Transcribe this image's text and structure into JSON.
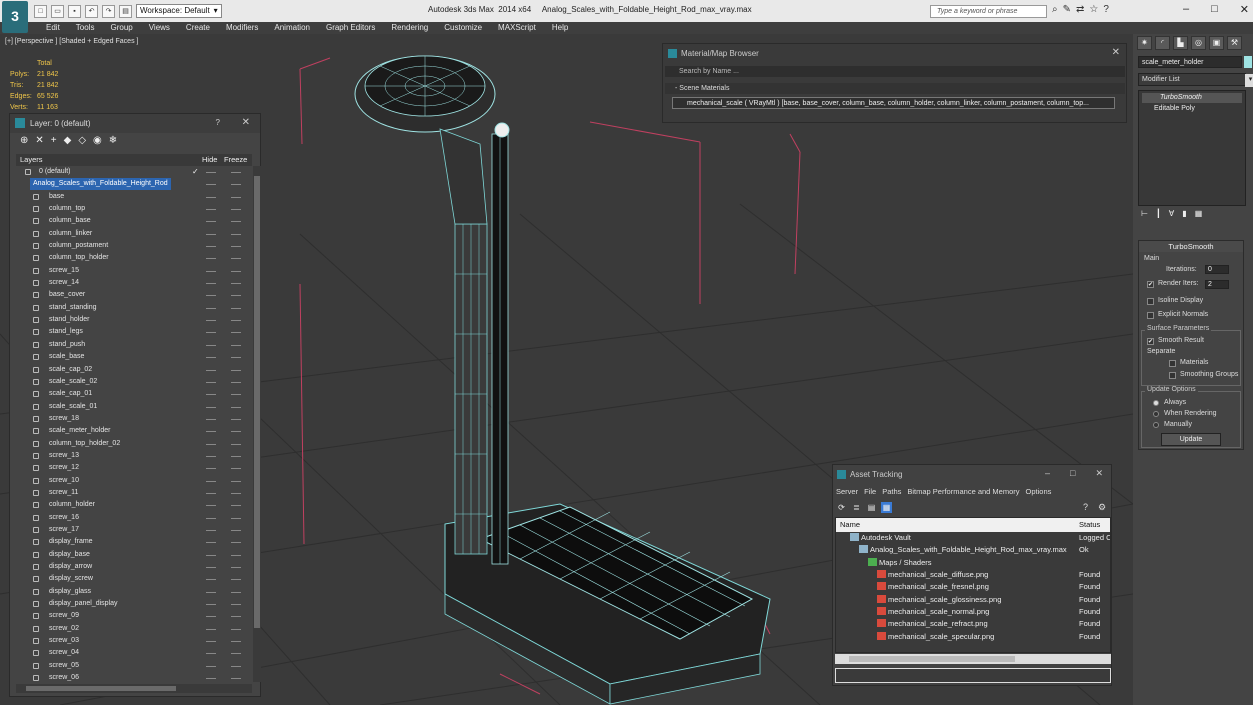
{
  "app": {
    "logo_text": "3",
    "title": "Autodesk 3ds Max  2014 x64     Analog_Scales_with_Foldable_Height_Rod_max_vray.max",
    "workspace_label": "Workspace: Default",
    "help_search_placeholder": "Type a keyword or phrase"
  },
  "menu": [
    "Edit",
    "Tools",
    "Group",
    "Views",
    "Create",
    "Modifiers",
    "Animation",
    "Graph Editors",
    "Rendering",
    "Customize",
    "MAXScript",
    "Help"
  ],
  "viewport": {
    "label": "[+] [Perspective ] [Shaded + Edged Faces ]",
    "stats": {
      "header": "Total",
      "rows": [
        {
          "label": "Polys:",
          "value": "21 842"
        },
        {
          "label": "Tris:",
          "value": "21 842"
        },
        {
          "label": "Edges:",
          "value": "65 526"
        },
        {
          "label": "Verts:",
          "value": "11 163"
        }
      ]
    }
  },
  "layer_panel": {
    "title": "Layer: 0 (default)",
    "help": "?",
    "columns": {
      "name": "Layers",
      "hide": "Hide",
      "freeze": "Freeze"
    },
    "layers": [
      {
        "name": "0 (default)",
        "type": "layer"
      },
      {
        "name": "Analog_Scales_with_Foldable_Height_Rod",
        "type": "selected"
      },
      {
        "name": "base"
      },
      {
        "name": "column_top"
      },
      {
        "name": "column_base"
      },
      {
        "name": "column_linker"
      },
      {
        "name": "column_postament"
      },
      {
        "name": "column_top_holder"
      },
      {
        "name": "screw_15"
      },
      {
        "name": "screw_14"
      },
      {
        "name": "base_cover"
      },
      {
        "name": "stand_standing"
      },
      {
        "name": "stand_holder"
      },
      {
        "name": "stand_legs"
      },
      {
        "name": "stand_push"
      },
      {
        "name": "scale_base"
      },
      {
        "name": "scale_cap_02"
      },
      {
        "name": "scale_scale_02"
      },
      {
        "name": "scale_cap_01"
      },
      {
        "name": "scale_scale_01"
      },
      {
        "name": "screw_18"
      },
      {
        "name": "scale_meter_holder"
      },
      {
        "name": "column_top_holder_02"
      },
      {
        "name": "screw_13"
      },
      {
        "name": "screw_12"
      },
      {
        "name": "screw_10"
      },
      {
        "name": "screw_11"
      },
      {
        "name": "column_holder"
      },
      {
        "name": "screw_16"
      },
      {
        "name": "screw_17"
      },
      {
        "name": "display_frame"
      },
      {
        "name": "display_base"
      },
      {
        "name": "display_arrow"
      },
      {
        "name": "display_screw"
      },
      {
        "name": "display_glass"
      },
      {
        "name": "display_panel_display"
      },
      {
        "name": "screw_09"
      },
      {
        "name": "screw_02"
      },
      {
        "name": "screw_03"
      },
      {
        "name": "screw_04"
      },
      {
        "name": "screw_05"
      },
      {
        "name": "screw_06"
      }
    ]
  },
  "material_browser": {
    "title": "Material/Map Browser",
    "search_placeholder": "Search by Name ...",
    "section": "- Scene Materials",
    "entry": "mechanical_scale  ( VRayMtl ) [base, base_cover, column_base, column_holder, column_linker, column_postament, column_top..."
  },
  "command_panel": {
    "object_name": "scale_meter_holder",
    "object_color": "#9fe3e3",
    "modifier_list": "Modifier List",
    "stack": [
      "TurboSmooth",
      "Editable Poly"
    ],
    "rollout_title": "TurboSmooth",
    "main_label": "Main",
    "iterations_label": "Iterations:",
    "iterations_value": "0",
    "render_iters_label": "Render Iters:",
    "render_iters_value": "2",
    "isoline_label": "Isoline Display",
    "explicit_label": "Explicit Normals",
    "surface_label": "Surface Parameters",
    "smooth_result_label": "Smooth Result",
    "separate_label": "Separate",
    "materials_label": "Materials",
    "smoothing_groups_label": "Smoothing Groups",
    "update_options_label": "Update Options",
    "always_label": "Always",
    "when_rendering_label": "When Rendering",
    "manually_label": "Manually",
    "update_button": "Update"
  },
  "asset_tracking": {
    "title": "Asset Tracking",
    "menu": [
      "Server",
      "File",
      "Paths",
      "Bitmap Performance and Memory",
      "Options"
    ],
    "columns": {
      "name": "Name",
      "status": "Status"
    },
    "rows": [
      {
        "name": "Autodesk Vault",
        "status": "Logged O",
        "indent": 0
      },
      {
        "name": "Analog_Scales_with_Foldable_Height_Rod_max_vray.max",
        "status": "Ok",
        "indent": 1
      },
      {
        "name": "Maps / Shaders",
        "status": "",
        "indent": 2
      },
      {
        "name": "mechanical_scale_diffuse.png",
        "status": "Found",
        "indent": 3
      },
      {
        "name": "mechanical_scale_fresnel.png",
        "status": "Found",
        "indent": 3
      },
      {
        "name": "mechanical_scale_glossiness.png",
        "status": "Found",
        "indent": 3
      },
      {
        "name": "mechanical_scale_normal.png",
        "status": "Found",
        "indent": 3
      },
      {
        "name": "mechanical_scale_refract.png",
        "status": "Found",
        "indent": 3
      },
      {
        "name": "mechanical_scale_specular.png",
        "status": "Found",
        "indent": 3
      }
    ]
  }
}
